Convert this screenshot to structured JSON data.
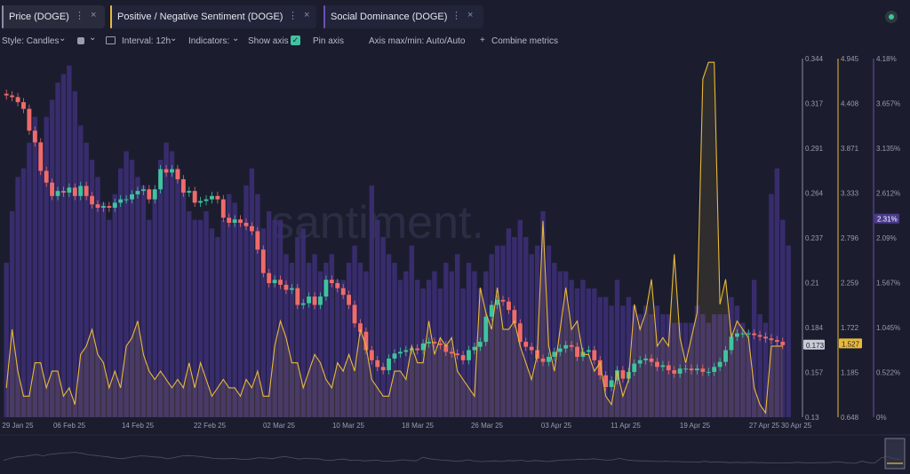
{
  "tabs": [
    {
      "label": "Price (DOGE)",
      "color": "#8b8ea3"
    },
    {
      "label": "Positive / Negative Sentiment (DOGE)",
      "color": "#e8b93a"
    },
    {
      "label": "Social Dominance (DOGE)",
      "color": "#6b4fb8"
    }
  ],
  "toolbar": {
    "style": "Style: Candles",
    "interval": "Interval: 12h",
    "indicators": "Indicators:",
    "show_axis": "Show axis",
    "pin_axis": "Pin axis",
    "axis_maxmin": "Axis max/min: Auto/Auto",
    "combine": "Combine metrics",
    "check_glyph": "✓",
    "menu_glyph": "⋮",
    "close_glyph": "×",
    "chevron_glyph": "⌄",
    "plus_glyph": "+"
  },
  "watermark": "santiment.",
  "chart_data": {
    "type": "candlestick+line+bar",
    "x_ticks": [
      "29 Jan 25",
      "06 Feb 25",
      "14 Feb 25",
      "22 Feb 25",
      "02 Mar 25",
      "10 Mar 25",
      "18 Mar 25",
      "26 Mar 25",
      "03 Apr 25",
      "11 Apr 25",
      "19 Apr 25",
      "27 Apr 25",
      "30 Apr 25"
    ],
    "price_axis": {
      "ticks": [
        "0.344",
        "0.317",
        "0.291",
        "0.264",
        "0.237",
        "0.21",
        "0.184",
        "0.157",
        "0.13"
      ],
      "min": 0.13,
      "max": 0.344,
      "current": "0.173"
    },
    "sentiment_axis": {
      "ticks": [
        "4.945",
        "4.408",
        "3.871",
        "3.333",
        "2.796",
        "2.259",
        "1.722",
        "1.185",
        "0.648"
      ],
      "min": 0.648,
      "max": 4.945,
      "current": "1.527"
    },
    "dominance_axis": {
      "ticks": [
        "4.18%",
        "3.657%",
        "3.135%",
        "2.612%",
        "2.09%",
        "1.567%",
        "1.045%",
        "0.522%",
        "0%"
      ],
      "min": 0,
      "max": 4.18,
      "current": "2.31%"
    },
    "price_close": [
      0.322,
      0.321,
      0.318,
      0.314,
      0.301,
      0.294,
      0.277,
      0.27,
      0.262,
      0.265,
      0.264,
      0.267,
      0.262,
      0.268,
      0.262,
      0.257,
      0.255,
      0.256,
      0.255,
      0.258,
      0.26,
      0.26,
      0.263,
      0.265,
      0.266,
      0.26,
      0.266,
      0.278,
      0.276,
      0.278,
      0.272,
      0.264,
      0.265,
      0.258,
      0.259,
      0.26,
      0.262,
      0.26,
      0.249,
      0.246,
      0.248,
      0.246,
      0.244,
      0.241,
      0.23,
      0.216,
      0.21,
      0.212,
      0.209,
      0.206,
      0.207,
      0.197,
      0.198,
      0.202,
      0.197,
      0.202,
      0.212,
      0.21,
      0.207,
      0.203,
      0.197,
      0.186,
      0.181,
      0.17,
      0.164,
      0.16,
      0.158,
      0.165,
      0.168,
      0.169,
      0.17,
      0.171,
      0.17,
      0.174,
      0.175,
      0.174,
      0.173,
      0.169,
      0.168,
      0.167,
      0.164,
      0.17,
      0.172,
      0.175,
      0.19,
      0.197,
      0.2,
      0.199,
      0.194,
      0.186,
      0.175,
      0.172,
      0.17,
      0.165,
      0.163,
      0.166,
      0.169,
      0.171,
      0.173,
      0.172,
      0.166,
      0.169,
      0.17,
      0.164,
      0.155,
      0.148,
      0.152,
      0.158,
      0.153,
      0.157,
      0.162,
      0.164,
      0.165,
      0.163,
      0.16,
      0.161,
      0.158,
      0.156,
      0.159,
      0.159,
      0.158,
      0.159,
      0.157,
      0.157,
      0.16,
      0.163,
      0.17,
      0.178,
      0.18,
      0.18,
      0.18,
      0.179,
      0.178,
      0.177,
      0.176,
      0.175,
      0.173
    ],
    "sentiment": [
      1.0,
      1.7,
      1.2,
      0.9,
      0.9,
      1.3,
      1.3,
      1.0,
      1.2,
      1.2,
      0.9,
      1.0,
      0.8,
      1.4,
      1.5,
      1.7,
      1.4,
      1.3,
      1.0,
      1.2,
      1.0,
      1.5,
      1.6,
      1.8,
      1.4,
      1.2,
      1.1,
      1.2,
      1.1,
      1.0,
      1.1,
      1.0,
      1.3,
      1.0,
      1.3,
      1.1,
      0.9,
      1.0,
      1.1,
      1.0,
      1.0,
      0.9,
      1.1,
      1.0,
      1.2,
      0.9,
      0.9,
      1.5,
      1.8,
      1.6,
      1.3,
      1.3,
      1.0,
      1.2,
      1.4,
      1.3,
      1.1,
      1.0,
      1.3,
      1.2,
      1.4,
      1.2,
      1.7,
      1.5,
      1.1,
      1.0,
      0.9,
      0.9,
      1.2,
      1.2,
      1.1,
      1.5,
      1.3,
      1.3,
      1.8,
      1.4,
      1.6,
      1.5,
      1.6,
      1.2,
      1.1,
      1.0,
      0.9,
      2.2,
      1.9,
      1.7,
      2.2,
      1.7,
      1.7,
      1.8,
      1.5,
      1.3,
      1.1,
      1.4,
      3.0,
      1.5,
      1.2,
      1.7,
      2.2,
      1.7,
      1.8,
      1.4,
      1.4,
      1.2,
      1.3,
      0.9,
      0.8,
      1.2,
      0.9,
      1.1,
      2.0,
      1.7,
      1.9,
      2.3,
      1.5,
      1.6,
      1.5,
      2.6,
      1.6,
      1.3,
      1.6,
      1.9,
      4.7,
      4.9,
      4.9,
      2.0,
      2.3,
      1.6,
      1.8,
      1.7,
      1.6,
      1.0,
      0.8,
      0.7,
      1.5,
      1.5,
      1.5
    ],
    "dominance": [
      1.8,
      2.4,
      2.8,
      2.9,
      3.2,
      3.5,
      3.1,
      3.5,
      3.7,
      3.9,
      4.0,
      4.1,
      3.8,
      3.4,
      3.2,
      3.0,
      2.8,
      2.5,
      2.3,
      2.6,
      2.9,
      3.1,
      3.0,
      2.8,
      2.7,
      2.3,
      2.6,
      3.0,
      3.2,
      3.1,
      2.9,
      2.7,
      2.4,
      2.3,
      2.3,
      2.4,
      2.2,
      2.1,
      2.3,
      2.6,
      2.5,
      2.3,
      2.7,
      2.9,
      2.6,
      2.2,
      2.4,
      2.3,
      2.3,
      1.9,
      1.8,
      2.1,
      2.2,
      1.8,
      1.9,
      1.7,
      1.8,
      1.9,
      1.6,
      1.6,
      1.8,
      2.0,
      1.8,
      1.7,
      2.7,
      2.3,
      2.1,
      1.9,
      1.8,
      1.6,
      1.7,
      2.0,
      1.6,
      1.5,
      1.6,
      1.7,
      1.5,
      1.8,
      1.7,
      1.9,
      1.5,
      1.8,
      1.7,
      1.5,
      1.7,
      1.9,
      2.0,
      2.0,
      2.2,
      2.1,
      2.3,
      2.1,
      1.9,
      2.0,
      2.4,
      2.0,
      1.8,
      1.7,
      1.7,
      1.6,
      1.5,
      1.6,
      1.5,
      1.5,
      1.4,
      1.4,
      1.3,
      1.6,
      1.3,
      1.4,
      1.3,
      1.2,
      1.3,
      1.2,
      1.3,
      1.2,
      1.2,
      1.1,
      1.1,
      1.1,
      1.1,
      1.3,
      1.2,
      1.1,
      1.2,
      1.2,
      1.2,
      1.4,
      1.3,
      1.1,
      1.0,
      1.6,
      1.2,
      1.1,
      2.6,
      2.9,
      2.3,
      2.0
    ]
  }
}
